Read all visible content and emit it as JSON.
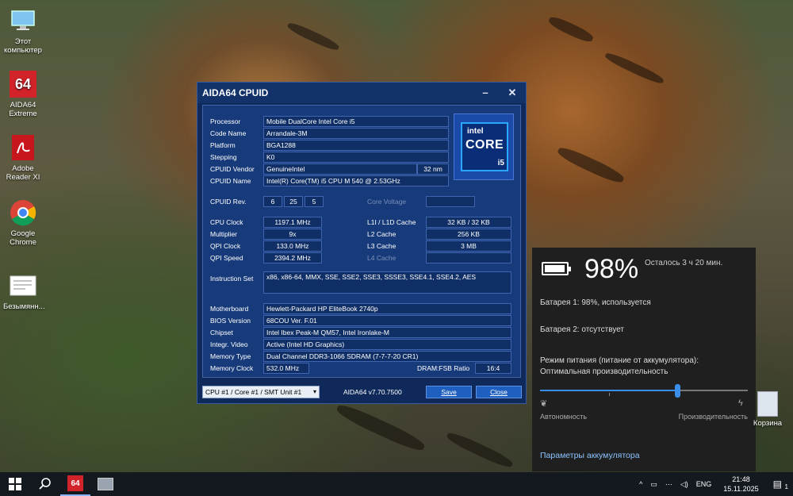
{
  "desktop": {
    "icons": [
      {
        "label": "Этот компьютер",
        "icon": "computer-icon"
      },
      {
        "label": "AIDA64 Extreme",
        "icon": "aida64-icon",
        "badge": "64"
      },
      {
        "label": "Adobe Reader XI",
        "icon": "pdf-icon"
      },
      {
        "label": "Google Chrome",
        "icon": "chrome-icon"
      },
      {
        "label": "Безымянн...",
        "icon": "document-icon"
      }
    ],
    "recycle_bin": "Корзина"
  },
  "aida": {
    "title": "AIDA64 CPUID",
    "minimize": "–",
    "close": "✕",
    "processor_label": "Processor",
    "processor": "Mobile DualCore Intel Core i5",
    "codename_label": "Code Name",
    "codename": "Arrandale-3M",
    "platform_label": "Platform",
    "platform": "BGA1288",
    "stepping_label": "Stepping",
    "stepping": "K0",
    "vendor_label": "CPUID Vendor",
    "vendor": "GenuineIntel",
    "process": "32 nm",
    "cpuid_name_label": "CPUID Name",
    "cpuid_name": "Intel(R) Core(TM) i5 CPU M 540 @ 2.53GHz",
    "badge_brand": "intel",
    "badge_core": "CORE",
    "badge_model": "i5",
    "rev_label": "CPUID Rev.",
    "rev": [
      "6",
      "25",
      "5"
    ],
    "core_voltage_label": "Core Voltage",
    "cpu_clock_label": "CPU Clock",
    "cpu_clock": "1197.1 MHz",
    "multiplier_label": "Multiplier",
    "multiplier": "9x",
    "qpi_clock_label": "QPI Clock",
    "qpi_clock": "133.0 MHz",
    "qpi_speed_label": "QPI Speed",
    "qpi_speed": "2394.2 MHz",
    "l1_label": "L1I / L1D Cache",
    "l1": "32 KB / 32 KB",
    "l2_label": "L2 Cache",
    "l2": "256 KB",
    "l3_label": "L3 Cache",
    "l3": "3 MB",
    "l4_label": "L4 Cache",
    "iset_label": "Instruction Set",
    "iset": "x86, x86-64, MMX, SSE, SSE2, SSE3, SSSE3, SSE4.1, SSE4.2, AES",
    "mb_label": "Motherboard",
    "mb": "Hewlett-Packard HP EliteBook 2740p",
    "bios_label": "BIOS Version",
    "bios": "68COU Ver. F.01",
    "chipset_label": "Chipset",
    "chipset": "Intel Ibex Peak-M QM57, Intel Ironlake-M",
    "video_label": "Integr. Video",
    "video": "Active  (Intel HD Graphics)",
    "memtype_label": "Memory Type",
    "memtype": "Dual Channel DDR3-1066 SDRAM  (7-7-7-20 CR1)",
    "memclock_label": "Memory Clock",
    "memclock": "532.0 MHz",
    "dram_label": "DRAM:FSB Ratio",
    "dram": "16:4",
    "selector": "CPU #1 / Core #1 / SMT Unit #1",
    "version": "AIDA64 v7.70.7500",
    "save": "Save",
    "close_btn": "Close"
  },
  "battery": {
    "percent": "98%",
    "level": 0.98,
    "remaining": "Осталось 3 ч 20 мин.",
    "battery1": "Батарея 1: 98%, используется",
    "battery2": "Батарея 2: отсутствует",
    "mode_title": "Режим питания (питание от аккумулятора):",
    "mode_value": "Оптимальная производительность",
    "slider_position": 0.66,
    "left_label": "Автономность",
    "right_label": "Производительность",
    "settings_link": "Параметры аккумулятора"
  },
  "taskbar": {
    "lang": "ENG",
    "time": "21:48",
    "date": "15.11.2025",
    "notifications": "1",
    "aida_badge": "64"
  }
}
